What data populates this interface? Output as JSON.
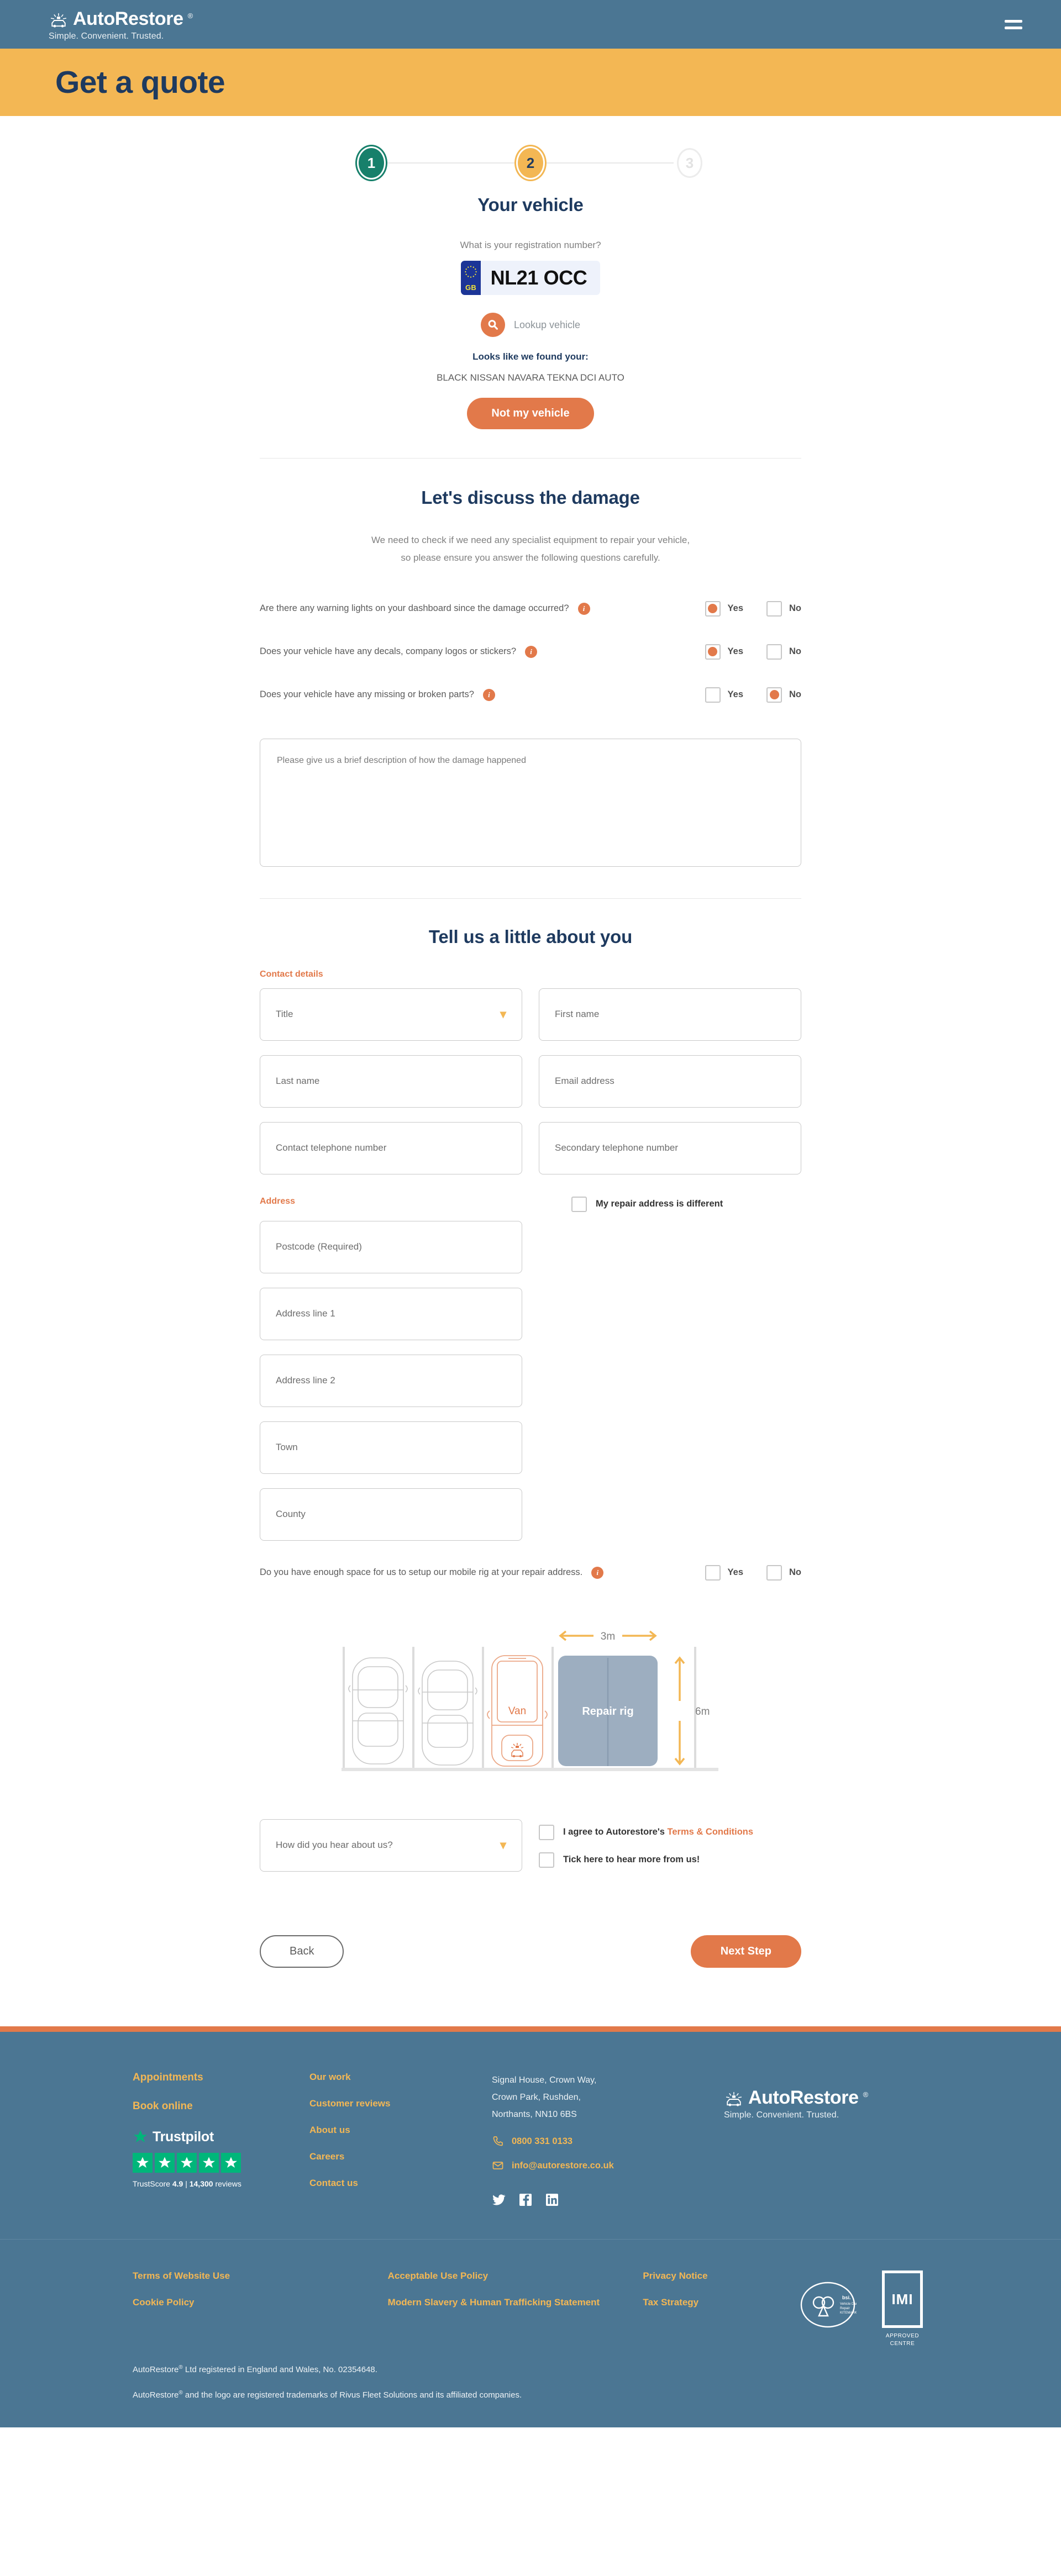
{
  "header": {
    "brand_name": "AutoRestore",
    "brand_reg": "®",
    "tagline": "Simple. Convenient. Trusted.",
    "menu_icon": "hamburger-menu-icon"
  },
  "hero": {
    "title": "Get a quote"
  },
  "stepper": {
    "steps": [
      {
        "label": "1",
        "state": "done"
      },
      {
        "label": "2",
        "state": "current"
      },
      {
        "label": "3",
        "state": "pending"
      }
    ]
  },
  "vehicle": {
    "title": "Your vehicle",
    "registration_question": "What is your registration number?",
    "plate_country": "GB",
    "plate_value": "NL21 OCC",
    "lookup_label": "Lookup vehicle",
    "found_label": "Looks like we found your:",
    "found_vehicle": "BLACK NISSAN NAVARA TEKNA DCI AUTO",
    "not_my_vehicle_button": "Not my vehicle"
  },
  "damage": {
    "title": "Let's discuss the damage",
    "intro_line1": "We need to check if we need any specialist equipment to repair your vehicle,",
    "intro_line2": "so please ensure you answer the following questions carefully.",
    "questions": [
      {
        "text": "Are there any warning lights on your dashboard since the damage occurred?",
        "yes_label": "Yes",
        "no_label": "No",
        "selected": "yes"
      },
      {
        "text": "Does your vehicle have any decals, company logos or stickers?",
        "yes_label": "Yes",
        "no_label": "No",
        "selected": "yes"
      },
      {
        "text": "Does your vehicle have any missing or broken parts?",
        "yes_label": "Yes",
        "no_label": "No",
        "selected": "no"
      }
    ],
    "description_placeholder": "Please give us a brief description of how the damage happened"
  },
  "about_you": {
    "title": "Tell us a little about you",
    "contact_details_label": "Contact details",
    "fields": {
      "title_select": "Title",
      "first_name": "First name",
      "last_name": "Last name",
      "email": "Email address",
      "contact_phone": "Contact telephone number",
      "secondary_phone": "Secondary telephone number"
    },
    "address_label": "Address",
    "repair_address_checkbox": "My repair address is different",
    "address_fields": {
      "postcode": "Postcode (Required)",
      "line1": "Address line 1",
      "line2": "Address line 2",
      "town": "Town",
      "county": "County"
    },
    "space_question": {
      "text": "Do you have enough space for us to setup our mobile rig at your repair address.",
      "yes_label": "Yes",
      "no_label": "No",
      "selected": "none"
    },
    "hear_about_us_select": "How did you hear about us?",
    "terms_prefix": "I agree to Autorestore's ",
    "terms_link": "Terms & Conditions",
    "marketing_optin": "Tick here to hear more from us!",
    "back_button": "Back",
    "next_button": "Next Step"
  },
  "diagram": {
    "width_label": "3m",
    "height_label": "6m",
    "van_label": "Van",
    "rig_label": "Repair rig"
  },
  "footer": {
    "col1": {
      "links": [
        "Appointments",
        "Book online"
      ],
      "trustpilot_name": "Trustpilot",
      "trustscore_prefix": "TrustScore ",
      "trustscore_value": "4.9",
      "trustscore_sep": " | ",
      "review_count": "14,300",
      "review_word": " reviews",
      "stars": 5
    },
    "col2": {
      "links": [
        "Our work",
        "Customer reviews",
        "About us",
        "Careers",
        "Contact us"
      ]
    },
    "col3": {
      "address_line1": "Signal House, Crown Way,",
      "address_line2": "Crown Park, Rushden,",
      "address_line3": "Northants, NN10 6BS",
      "phone": "0800 331 0133",
      "email": "info@autorestore.co.uk",
      "socials": [
        "twitter-icon",
        "facebook-icon",
        "linkedin-icon"
      ]
    },
    "col4": {
      "brand_name": "AutoRestore",
      "brand_reg": "®",
      "tagline": "Simple. Convenient. Trusted."
    },
    "bottom": {
      "links_col1": [
        "Terms of Website Use",
        "Cookie Policy"
      ],
      "links_col2": [
        "Acceptable Use Policy",
        "Modern Slavery & Human Trafficking Statement"
      ],
      "links_col3": [
        "Privacy Notice",
        "Tax Strategy"
      ],
      "legal1_pre": "AutoRestore",
      "legal1_post": " Ltd registered in England and Wales, No. 02354648.",
      "legal2_pre": "AutoRestore",
      "legal2_post": " and the logo are registered trademarks of Rivus Fleet Solutions and its affiliated companies.",
      "imi_text": "IMI",
      "imi_caption_line1": "APPROVED",
      "imi_caption_line2": "CENTRE",
      "bsi_line1": "bsi.",
      "bsi_line2": "Vehicle Damage",
      "bsi_line3": "Repair",
      "bsi_line4": "KITEMARK™"
    }
  },
  "colors": {
    "brand_blue": "#4b7693",
    "hero_yellow": "#f3b754",
    "accent_orange": "#e2794a",
    "navy": "#1e3a5f",
    "green_step": "#17806b",
    "trustpilot_green": "#00b67a",
    "rig_grey": "#9daec0"
  }
}
